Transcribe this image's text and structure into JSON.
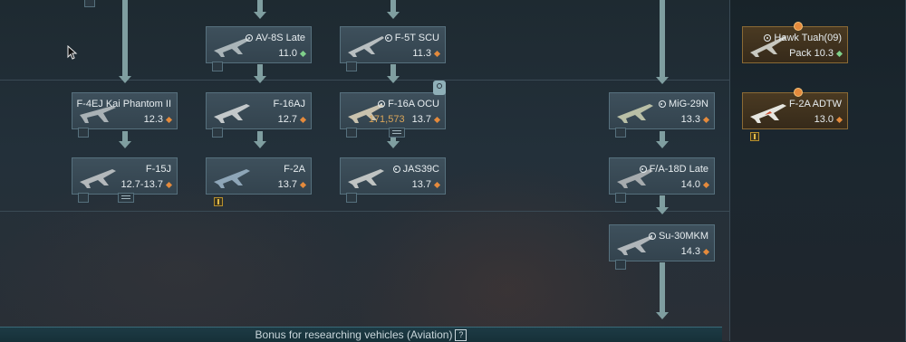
{
  "cards": {
    "av8s": {
      "name": "AV-8S Late",
      "br": "11.0"
    },
    "f5t": {
      "name": "F-5T SCU",
      "br": "11.3"
    },
    "hawk": {
      "name": "Hawk Tuah(09)",
      "br": "Pack 10.3"
    },
    "f4ej": {
      "name": "F-4EJ Kai Phantom II",
      "br": "12.3"
    },
    "f16aj": {
      "name": "F-16AJ",
      "br": "12.7"
    },
    "f16aocu": {
      "name": "F-16A OCU",
      "br": "13.7",
      "cost": "171,573"
    },
    "mig29n": {
      "name": "MiG-29N",
      "br": "13.3"
    },
    "f2aadtw": {
      "name": "F-2A ADTW",
      "br": "13.0"
    },
    "f15j": {
      "name": "F-15J",
      "br": "12.7-13.7"
    },
    "f2a": {
      "name": "F-2A",
      "br": "13.7"
    },
    "jas39c": {
      "name": "JAS39C",
      "br": "13.7"
    },
    "fa18d": {
      "name": "F/A-18D Late",
      "br": "14.0"
    },
    "su30mkm": {
      "name": "Su-30MKM",
      "br": "14.3"
    }
  },
  "bonus_bar": {
    "label": "Bonus for researching vehicles (Aviation)",
    "help": "?"
  },
  "colors": {
    "accent_orange": "#e48a3c",
    "accent_green": "#7fd08a",
    "arrow": "#7f9ea0",
    "card_bg": "#3e505c"
  },
  "icons": [
    "target-icon",
    "br-diamond-icon",
    "pin-icon",
    "gift-icon",
    "list-icon",
    "cursor-icon"
  ]
}
